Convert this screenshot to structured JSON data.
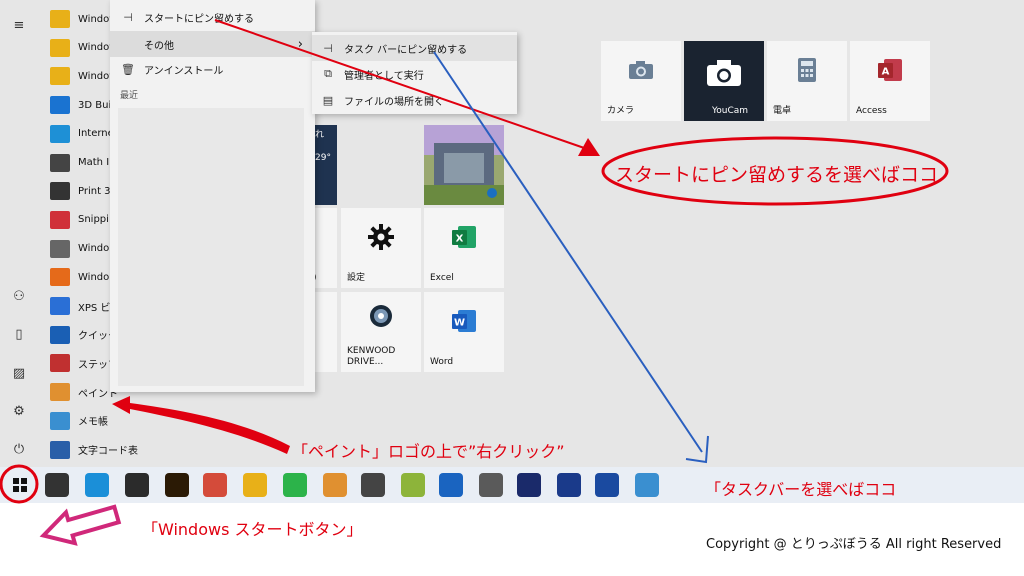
{
  "applist": [
    {
      "label": "Windows",
      "icon": "folder-icon",
      "color": "#e8b018"
    },
    {
      "label": "Windows",
      "icon": "folder-icon",
      "color": "#e8b018"
    },
    {
      "label": "Windows",
      "icon": "folder-icon",
      "color": "#e8b018"
    },
    {
      "label": "3D Bui",
      "icon": "3d-builder-icon",
      "color": "#1a73d1"
    },
    {
      "label": "Interne",
      "icon": "internet-explorer-icon",
      "color": "#1e90d6"
    },
    {
      "label": "Math In",
      "icon": "math-input-icon",
      "color": "#444444"
    },
    {
      "label": "Print 3",
      "icon": "print-3d-icon",
      "color": "#333333"
    },
    {
      "label": "Snippi",
      "icon": "snipping-tool-icon",
      "color": "#d0303a"
    },
    {
      "label": "Windo",
      "icon": "fax-scan-icon",
      "color": "#666666"
    },
    {
      "label": "Windo",
      "icon": "media-player-icon",
      "color": "#e56a1a"
    },
    {
      "label": "XPS ビ",
      "icon": "xps-viewer-icon",
      "color": "#2a6fd6"
    },
    {
      "label": "クイック",
      "icon": "quick-assist-icon",
      "color": "#1a5fb4"
    },
    {
      "label": "ステップ",
      "icon": "steps-recorder-icon",
      "color": "#c03030"
    },
    {
      "label": "ペイント",
      "icon": "paint-icon",
      "color": "#e09030"
    },
    {
      "label": "メモ帳",
      "icon": "notepad-icon",
      "color": "#3a8fd0"
    },
    {
      "label": "文字コード表",
      "icon": "character-map-icon",
      "color": "#2a5fa8"
    }
  ],
  "context_menu": {
    "items": [
      {
        "label": "スタートにピン留めする",
        "icon": "pin-icon"
      },
      {
        "label": "その他",
        "icon": "",
        "arrow": "›"
      },
      {
        "label": "アンインストール",
        "icon": "trash-icon"
      }
    ],
    "recent_label": "最近"
  },
  "submenu": {
    "items": [
      {
        "label": "タスク バーにピン留めする",
        "icon": "pin-icon"
      },
      {
        "label": "管理者として実行",
        "icon": "admin-run-icon"
      },
      {
        "label": "ファイルの場所を開く",
        "icon": "file-location-icon"
      }
    ]
  },
  "tiles": {
    "camera": "カメラ",
    "youcam": "YouCam",
    "calculator": "電卓",
    "access": "Access",
    "weather": "れ",
    "weather_temp": "29°",
    "settings": "設定",
    "excel": "Excel",
    "partial": ")",
    "kenwood": "KENWOOD DRIVE...",
    "word": "Word"
  },
  "annotations": {
    "pin_start": "スタートにピン留めするを選べばココ",
    "paint_logo": "「ペイント」ロゴの上で”右クリック”",
    "taskbar": "「タスクバーを選べばココ",
    "start_button": "「Windows スタートボタン」"
  },
  "copyright": "Copyright @ とりっぷぼうる All right Reserved",
  "taskbar_icons": [
    {
      "name": "task-view-icon",
      "color": "#333333"
    },
    {
      "name": "edge-icon",
      "color": "#1b8fd8"
    },
    {
      "name": "store-icon",
      "color": "#2b2b2b"
    },
    {
      "name": "illustrator-icon",
      "color": "#2b1a05"
    },
    {
      "name": "chrome-icon",
      "color": "#d44b3a"
    },
    {
      "name": "file-explorer-icon",
      "color": "#e8b018"
    },
    {
      "name": "line-icon",
      "color": "#2cb34a"
    },
    {
      "name": "paint-taskbar-icon",
      "color": "#e09030"
    },
    {
      "name": "film-icon",
      "color": "#444444"
    },
    {
      "name": "maps-icon",
      "color": "#8db43a"
    },
    {
      "name": "outlook-icon",
      "color": "#1a64c0"
    },
    {
      "name": "camera-app-icon",
      "color": "#5a5a5a"
    },
    {
      "name": "dvd-icon",
      "color": "#1a2a6a"
    },
    {
      "name": "disc-icon",
      "color": "#1a3a8a"
    },
    {
      "name": "remote-desktop-icon",
      "color": "#1a4aa0"
    },
    {
      "name": "notepad-taskbar-icon",
      "color": "#3a8fd0"
    }
  ]
}
